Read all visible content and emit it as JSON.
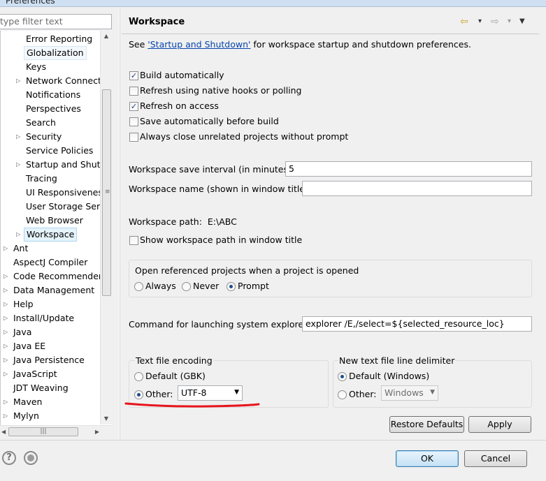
{
  "window": {
    "title": "Preferences"
  },
  "filter": {
    "value": "type filter text"
  },
  "tree": {
    "items": [
      {
        "label": "Error Reporting",
        "expandable": false,
        "level": 1
      },
      {
        "label": "Globalization",
        "expandable": false,
        "level": 1
      },
      {
        "label": "Keys",
        "expandable": false,
        "level": 1
      },
      {
        "label": "Network Connectio",
        "expandable": true,
        "level": 1
      },
      {
        "label": "Notifications",
        "expandable": false,
        "level": 1
      },
      {
        "label": "Perspectives",
        "expandable": false,
        "level": 1
      },
      {
        "label": "Search",
        "expandable": false,
        "level": 1
      },
      {
        "label": "Security",
        "expandable": true,
        "level": 1
      },
      {
        "label": "Service Policies",
        "expandable": false,
        "level": 1
      },
      {
        "label": "Startup and Shutdo",
        "expandable": true,
        "level": 1
      },
      {
        "label": "Tracing",
        "expandable": false,
        "level": 1
      },
      {
        "label": "UI Responsiveness",
        "expandable": false,
        "level": 1
      },
      {
        "label": "User Storage Servi",
        "expandable": false,
        "level": 1
      },
      {
        "label": "Web Browser",
        "expandable": false,
        "level": 1
      },
      {
        "label": "Workspace",
        "expandable": true,
        "level": 1
      },
      {
        "label": "Ant",
        "expandable": true,
        "level": 0
      },
      {
        "label": "AspectJ Compiler",
        "expandable": false,
        "level": 0
      },
      {
        "label": "Code Recommenders",
        "expandable": true,
        "level": 0
      },
      {
        "label": "Data Management",
        "expandable": true,
        "level": 0
      },
      {
        "label": "Help",
        "expandable": true,
        "level": 0
      },
      {
        "label": "Install/Update",
        "expandable": true,
        "level": 0
      },
      {
        "label": "Java",
        "expandable": true,
        "level": 0
      },
      {
        "label": "Java EE",
        "expandable": true,
        "level": 0
      },
      {
        "label": "Java Persistence",
        "expandable": true,
        "level": 0
      },
      {
        "label": "JavaScript",
        "expandable": true,
        "level": 0
      },
      {
        "label": "JDT Weaving",
        "expandable": false,
        "level": 0
      },
      {
        "label": "Maven",
        "expandable": true,
        "level": 0
      },
      {
        "label": "Mylyn",
        "expandable": true,
        "level": 0
      }
    ],
    "selected": "Workspace",
    "highlighted": "Globalization"
  },
  "page": {
    "title": "Workspace",
    "intro_prefix": "See ",
    "intro_link": "'Startup and Shutdown'",
    "intro_suffix": " for workspace startup and shutdown preferences.",
    "checkboxes": [
      {
        "label": "Build automatically",
        "checked": true
      },
      {
        "label": "Refresh using native hooks or polling",
        "checked": false
      },
      {
        "label": "Refresh on access",
        "checked": true
      },
      {
        "label": "Save automatically before build",
        "checked": false
      },
      {
        "label": "Always close unrelated projects without prompt",
        "checked": false
      }
    ],
    "save_interval": {
      "label": "Workspace save interval (in minutes):",
      "value": "5"
    },
    "workspace_name": {
      "label": "Workspace name (shown in window title):",
      "value": ""
    },
    "workspace_path": {
      "label": "Workspace path:",
      "value": "E:\\ABC"
    },
    "show_path": {
      "label": "Show workspace path in window title",
      "checked": false
    },
    "open_referenced": {
      "label": "Open referenced projects when a project is opened",
      "options": [
        "Always",
        "Never",
        "Prompt"
      ],
      "selected": "Prompt"
    },
    "explorer_command": {
      "label": "Command for launching system explorer:",
      "value": "explorer /E,/select=${selected_resource_loc}"
    },
    "encoding": {
      "label": "Text file encoding",
      "default_label": "Default (GBK)",
      "other_label": "Other:",
      "other_value": "UTF-8",
      "selected": "Other"
    },
    "line_delimiter": {
      "label": "New text file line delimiter",
      "default_label": "Default (Windows)",
      "other_label": "Other:",
      "other_value": "Windows",
      "selected": "Default"
    },
    "restore_defaults": "Restore Defaults",
    "apply": "Apply"
  },
  "dialog": {
    "ok": "OK",
    "cancel": "Cancel"
  },
  "nav": {
    "back": "⇦",
    "forward": "⇨",
    "dropdown": "▾",
    "menu": "▼"
  },
  "icons": {
    "help": "help-icon",
    "import_export": "preferences-import-icon"
  },
  "colors": {
    "annotation": "#e8141c",
    "link": "#0645ad"
  }
}
